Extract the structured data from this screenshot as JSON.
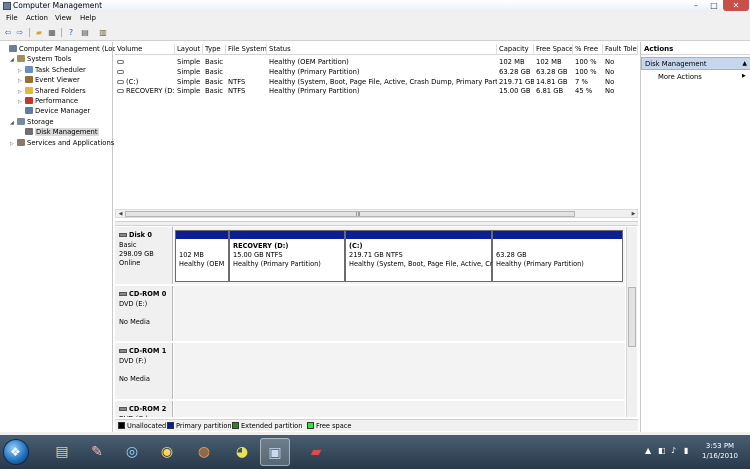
{
  "window": {
    "title": "Computer Management",
    "controls": {
      "minimize": "–",
      "maximize": "□",
      "close": "✕"
    }
  },
  "menu": [
    "File",
    "Action",
    "View",
    "Help"
  ],
  "tree": [
    {
      "label": "Computer Management (Local",
      "indent": 0,
      "expander": "",
      "icon": "computer-icon",
      "color": "#6b7f99"
    },
    {
      "label": "System Tools",
      "indent": 1,
      "expander": "◢",
      "icon": "tools-icon",
      "color": "#a58d5a"
    },
    {
      "label": "Task Scheduler",
      "indent": 2,
      "expander": "▷",
      "icon": "clock-icon",
      "color": "#6a8fbf"
    },
    {
      "label": "Event Viewer",
      "indent": 2,
      "expander": "▷",
      "icon": "event-viewer-icon",
      "color": "#9c6b3c"
    },
    {
      "label": "Shared Folders",
      "indent": 2,
      "expander": "▷",
      "icon": "folder-icon",
      "color": "#e2b642"
    },
    {
      "label": "Performance",
      "indent": 2,
      "expander": "▷",
      "icon": "performance-icon",
      "color": "#c0392b"
    },
    {
      "label": "Device Manager",
      "indent": 2,
      "expander": "",
      "icon": "device-manager-icon",
      "color": "#5d7ea3"
    },
    {
      "label": "Storage",
      "indent": 1,
      "expander": "◢",
      "icon": "storage-icon",
      "color": "#7a8a9a"
    },
    {
      "label": "Disk Management",
      "indent": 2,
      "expander": "",
      "icon": "disk-icon",
      "color": "#6f6f6f",
      "selected": true
    },
    {
      "label": "Services and Applications",
      "indent": 1,
      "expander": "▷",
      "icon": "services-icon",
      "color": "#8a7a6a"
    }
  ],
  "volumes": {
    "columns": [
      "Volume",
      "Layout",
      "Type",
      "File System",
      "Status",
      "Capacity",
      "Free Space",
      "% Free",
      "Fault Tole"
    ],
    "rows": [
      [
        "",
        "Simple",
        "Basic",
        "",
        "Healthy (OEM Partition)",
        "102 MB",
        "102 MB",
        "100 %",
        "No"
      ],
      [
        "",
        "Simple",
        "Basic",
        "",
        "Healthy (Primary Partition)",
        "63.28 GB",
        "63.28 GB",
        "100 %",
        "No"
      ],
      [
        "(C:)",
        "Simple",
        "Basic",
        "NTFS",
        "Healthy (System, Boot, Page File, Active, Crash Dump, Primary Partition)",
        "219.71 GB",
        "14.81 GB",
        "7 %",
        "No"
      ],
      [
        "RECOVERY (D:)",
        "Simple",
        "Basic",
        "NTFS",
        "Healthy (Primary Partition)",
        "15.00 GB",
        "6.81 GB",
        "45 %",
        "No"
      ]
    ],
    "scroll_grip": "III",
    "scroll_left": "◀",
    "scroll_right": "▶"
  },
  "disks": [
    {
      "name": "Disk 0",
      "lines": [
        "Basic",
        "298.09 GB",
        "Online"
      ],
      "partitions": [
        {
          "title": "",
          "size": "102 MB",
          "status": "Healthy (OEM"
        },
        {
          "title": "RECOVERY  (D:)",
          "size": "15.00 GB NTFS",
          "status": "Healthy (Primary Partition)"
        },
        {
          "title": "(C:)",
          "size": "219.71 GB NTFS",
          "status": "Healthy (System, Boot, Page File, Active, Cra"
        },
        {
          "title": "",
          "size": "63.28 GB",
          "status": "Healthy (Primary Partition)"
        }
      ]
    },
    {
      "name": "CD-ROM 0",
      "lines": [
        "DVD (E:)",
        "",
        "No Media"
      ]
    },
    {
      "name": "CD-ROM 1",
      "lines": [
        "DVD (F:)",
        "",
        "No Media"
      ]
    },
    {
      "name": "CD-ROM 2",
      "lines": [
        "DVD (G:)"
      ]
    }
  ],
  "legend": [
    {
      "label": "Unallocated",
      "color": "#000000"
    },
    {
      "label": "Primary partition",
      "color": "#0a1e96"
    },
    {
      "label": "Extended partition",
      "color": "#1e8c1e"
    },
    {
      "label": "Free space",
      "color": "#2ee82e"
    }
  ],
  "actions": {
    "header": "Actions",
    "section": "Disk Management",
    "section_arrow": "▲",
    "more": "More Actions",
    "more_arrow": "▶"
  },
  "taskbar": {
    "start_glyph": "❖",
    "apps": [
      {
        "name": "explorer-taskbar-button",
        "glyph": "▤",
        "color": "#f3d27a"
      },
      {
        "name": "paint-taskbar-button",
        "glyph": "✎",
        "color": "#ffb9b9"
      },
      {
        "name": "media-player-taskbar-button",
        "glyph": "◎",
        "color": "#9fd6ff"
      },
      {
        "name": "eye-app-taskbar-button",
        "glyph": "◉",
        "color": "#ffd75e"
      },
      {
        "name": "firefox-taskbar-button",
        "glyph": "◍",
        "color": "#ff9a3c"
      },
      {
        "name": "chrome-taskbar-button",
        "glyph": "◕",
        "color": "#e8e25a"
      },
      {
        "name": "computer-management-taskbar-button",
        "glyph": "▣",
        "color": "#c9d9ee",
        "active": true
      },
      {
        "name": "toolbox-taskbar-button",
        "glyph": "▰",
        "color": "#e24a4a"
      }
    ],
    "tray": [
      "▲",
      "◧",
      "♪",
      "▮"
    ],
    "time": "3:53 PM",
    "date": "1/16/2010"
  }
}
